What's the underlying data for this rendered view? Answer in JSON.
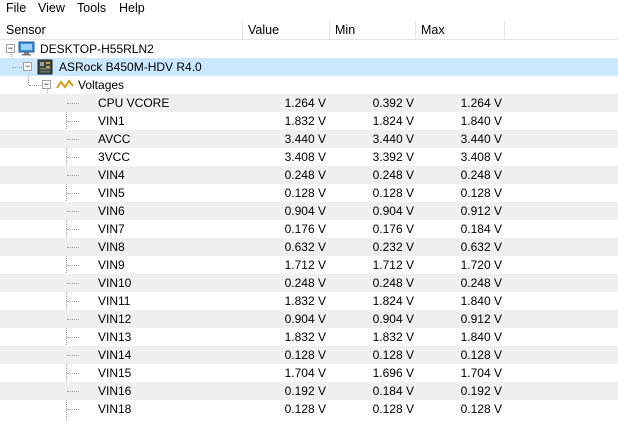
{
  "menu": {
    "items": [
      "File",
      "View",
      "Tools",
      "Help"
    ]
  },
  "columns": {
    "sensor": "Sensor",
    "value": "Value",
    "min": "Min",
    "max": "Max"
  },
  "tree": {
    "computer": {
      "label": "DESKTOP-H55RLN2",
      "icon": "computer-icon"
    },
    "board": {
      "label": "ASRock B450M-HDV R4.0",
      "icon": "motherboard-icon"
    },
    "group": {
      "label": "Voltages",
      "icon": "voltage-icon"
    },
    "sensors": [
      {
        "name": "CPU VCORE",
        "value": "1.264 V",
        "min": "0.392 V",
        "max": "1.264 V"
      },
      {
        "name": "VIN1",
        "value": "1.832 V",
        "min": "1.824 V",
        "max": "1.840 V"
      },
      {
        "name": "AVCC",
        "value": "3.440 V",
        "min": "3.440 V",
        "max": "3.440 V"
      },
      {
        "name": "3VCC",
        "value": "3.408 V",
        "min": "3.392 V",
        "max": "3.408 V"
      },
      {
        "name": "VIN4",
        "value": "0.248 V",
        "min": "0.248 V",
        "max": "0.248 V"
      },
      {
        "name": "VIN5",
        "value": "0.128 V",
        "min": "0.128 V",
        "max": "0.128 V"
      },
      {
        "name": "VIN6",
        "value": "0.904 V",
        "min": "0.904 V",
        "max": "0.912 V"
      },
      {
        "name": "VIN7",
        "value": "0.176 V",
        "min": "0.176 V",
        "max": "0.184 V"
      },
      {
        "name": "VIN8",
        "value": "0.632 V",
        "min": "0.232 V",
        "max": "0.632 V"
      },
      {
        "name": "VIN9",
        "value": "1.712 V",
        "min": "1.712 V",
        "max": "1.720 V"
      },
      {
        "name": "VIN10",
        "value": "0.248 V",
        "min": "0.248 V",
        "max": "0.248 V"
      },
      {
        "name": "VIN11",
        "value": "1.832 V",
        "min": "1.824 V",
        "max": "1.840 V"
      },
      {
        "name": "VIN12",
        "value": "0.904 V",
        "min": "0.904 V",
        "max": "0.912 V"
      },
      {
        "name": "VIN13",
        "value": "1.832 V",
        "min": "1.832 V",
        "max": "1.840 V"
      },
      {
        "name": "VIN14",
        "value": "0.128 V",
        "min": "0.128 V",
        "max": "0.128 V"
      },
      {
        "name": "VIN15",
        "value": "1.704 V",
        "min": "1.696 V",
        "max": "1.704 V"
      },
      {
        "name": "VIN16",
        "value": "0.192 V",
        "min": "0.184 V",
        "max": "0.192 V"
      },
      {
        "name": "VIN18",
        "value": "0.128 V",
        "min": "0.128 V",
        "max": "0.128 V"
      }
    ]
  },
  "colors": {
    "selected_row": "#cce8ff",
    "alt_row": "#f0f0f0",
    "voltage_icon": "#d4a017"
  }
}
